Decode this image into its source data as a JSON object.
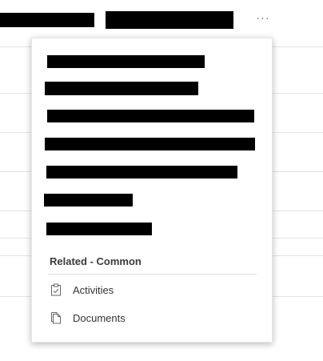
{
  "header": {
    "more_glyph": "···"
  },
  "menu": {
    "section_header": "Related - Common",
    "related_items": [
      {
        "label": "Activities",
        "icon": "clipboard-check-icon"
      },
      {
        "label": "Documents",
        "icon": "documents-icon"
      }
    ]
  },
  "colors": {
    "redaction": "#000000",
    "text": "#333333",
    "header_text": "#3b3b3b",
    "icon": "#666666"
  }
}
